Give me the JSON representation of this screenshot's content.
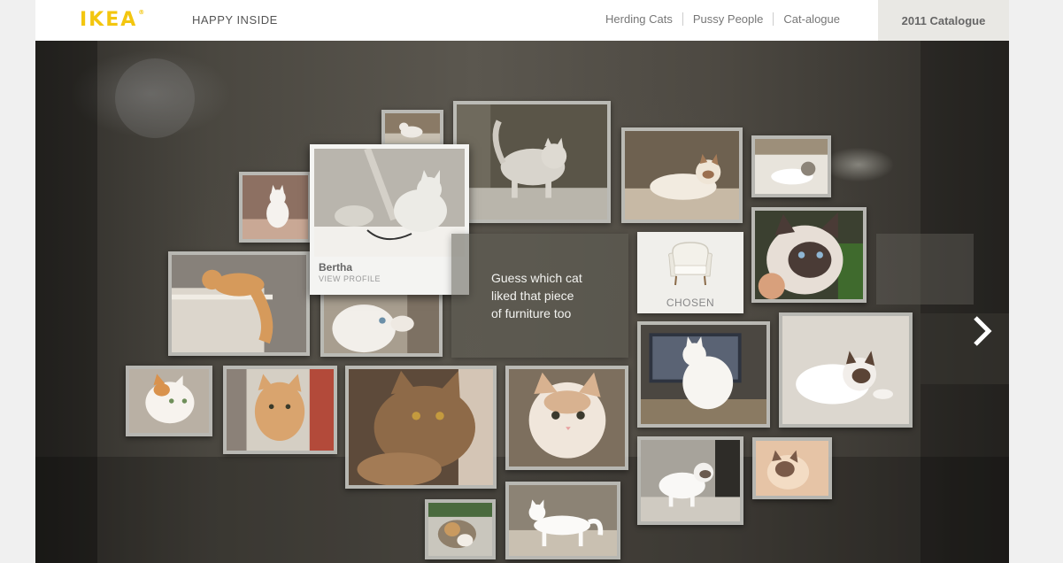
{
  "header": {
    "logo": "IKEA",
    "logo_mark": "®",
    "tagline": "HAPPY INSIDE",
    "nav": [
      "Herding Cats",
      "Pussy People",
      "Cat-alogue"
    ],
    "catalogue": "2011 Catalogue"
  },
  "featured_cat": {
    "name": "Bertha",
    "link": "VIEW PROFILE"
  },
  "message": {
    "lines": [
      "Guess which cat",
      "liked that piece",
      "of furniture too"
    ]
  },
  "chosen": {
    "label": "CHOSEN",
    "icon": "armchair-icon"
  },
  "navigation": {
    "next_icon": "chevron-right-icon"
  },
  "colors": {
    "brand_yellow": "#f3c60f",
    "header_bg": "#ffffff",
    "catalogue_bg": "#e9e8e4"
  }
}
